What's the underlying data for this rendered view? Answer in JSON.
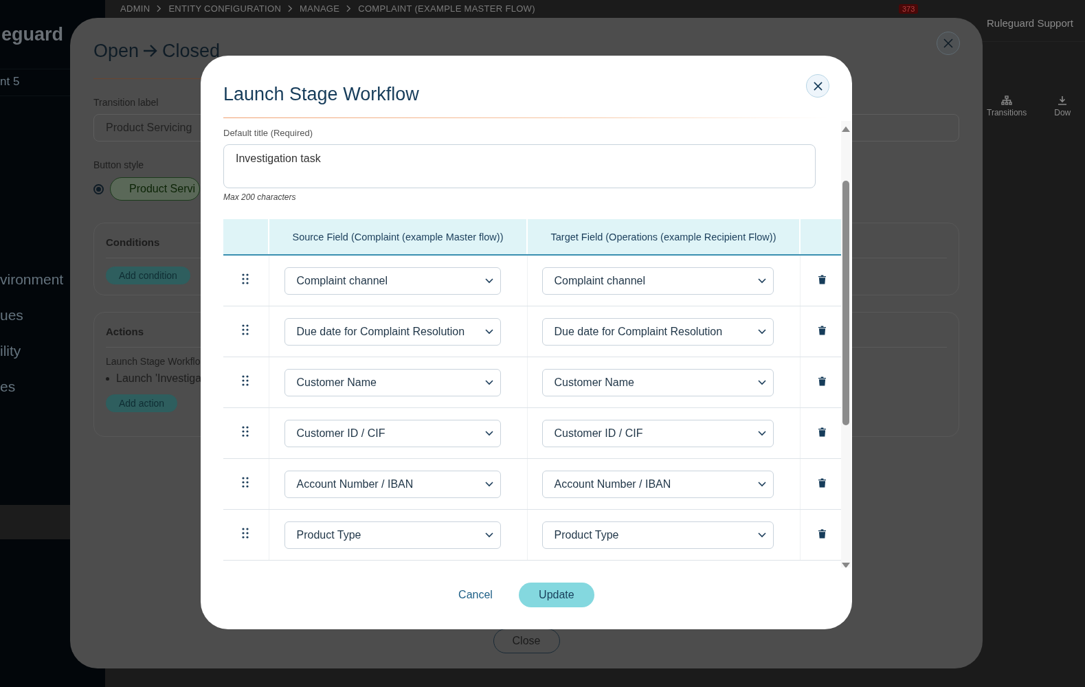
{
  "app": {
    "logo": "eguard",
    "sidebar_items": [
      "nt 5",
      "vironment",
      "ues",
      "ility",
      "es"
    ],
    "breadcrumbs": [
      "ADMIN",
      "ENTITY CONFIGURATION",
      "MANAGE",
      "COMPLAINT (EXAMPLE MASTER FLOW)"
    ],
    "notification_count": "373",
    "user": "Ruleguard Support",
    "toolbar": [
      {
        "label": "Transitions",
        "kind": "tree"
      },
      {
        "label": "Dow",
        "kind": "download"
      }
    ]
  },
  "transition_dialog": {
    "title_from": "Open",
    "title_to": "Closed",
    "transition_label": {
      "label": "Transition label",
      "value": "Product Servicing"
    },
    "button_style": {
      "label": "Button style",
      "options": [
        {
          "label": "Product Servi",
          "selected": true
        }
      ]
    },
    "conditions": {
      "title": "Conditions",
      "button": "Add condition"
    },
    "actions": {
      "title": "Actions",
      "item_type": "Launch Stage Workflo",
      "items": [
        "Launch 'Investiga"
      ],
      "button": "Add action"
    },
    "close_button": "Close"
  },
  "workflow_dialog": {
    "title": "Launch Stage Workflow",
    "default_title": {
      "label": "Default title (Required)",
      "value": "Investigation task",
      "hint": "Max 200 characters"
    },
    "mapping_table": {
      "columns": [
        "Source Field (Complaint (example Master flow))",
        "Target Field (Operations (example Recipient Flow))"
      ],
      "rows": [
        {
          "source": "Complaint channel",
          "target": "Complaint channel"
        },
        {
          "source": "Due date for Complaint Resolution",
          "target": "Due date for Complaint Resolution"
        },
        {
          "source": "Customer Name",
          "target": "Customer Name"
        },
        {
          "source": "Customer ID / CIF",
          "target": "Customer ID / CIF"
        },
        {
          "source": "Account Number / IBAN",
          "target": "Account Number / IBAN"
        },
        {
          "source": "Product Type",
          "target": "Product Type"
        }
      ]
    },
    "buttons": {
      "cancel": "Cancel",
      "update": "Update"
    }
  }
}
